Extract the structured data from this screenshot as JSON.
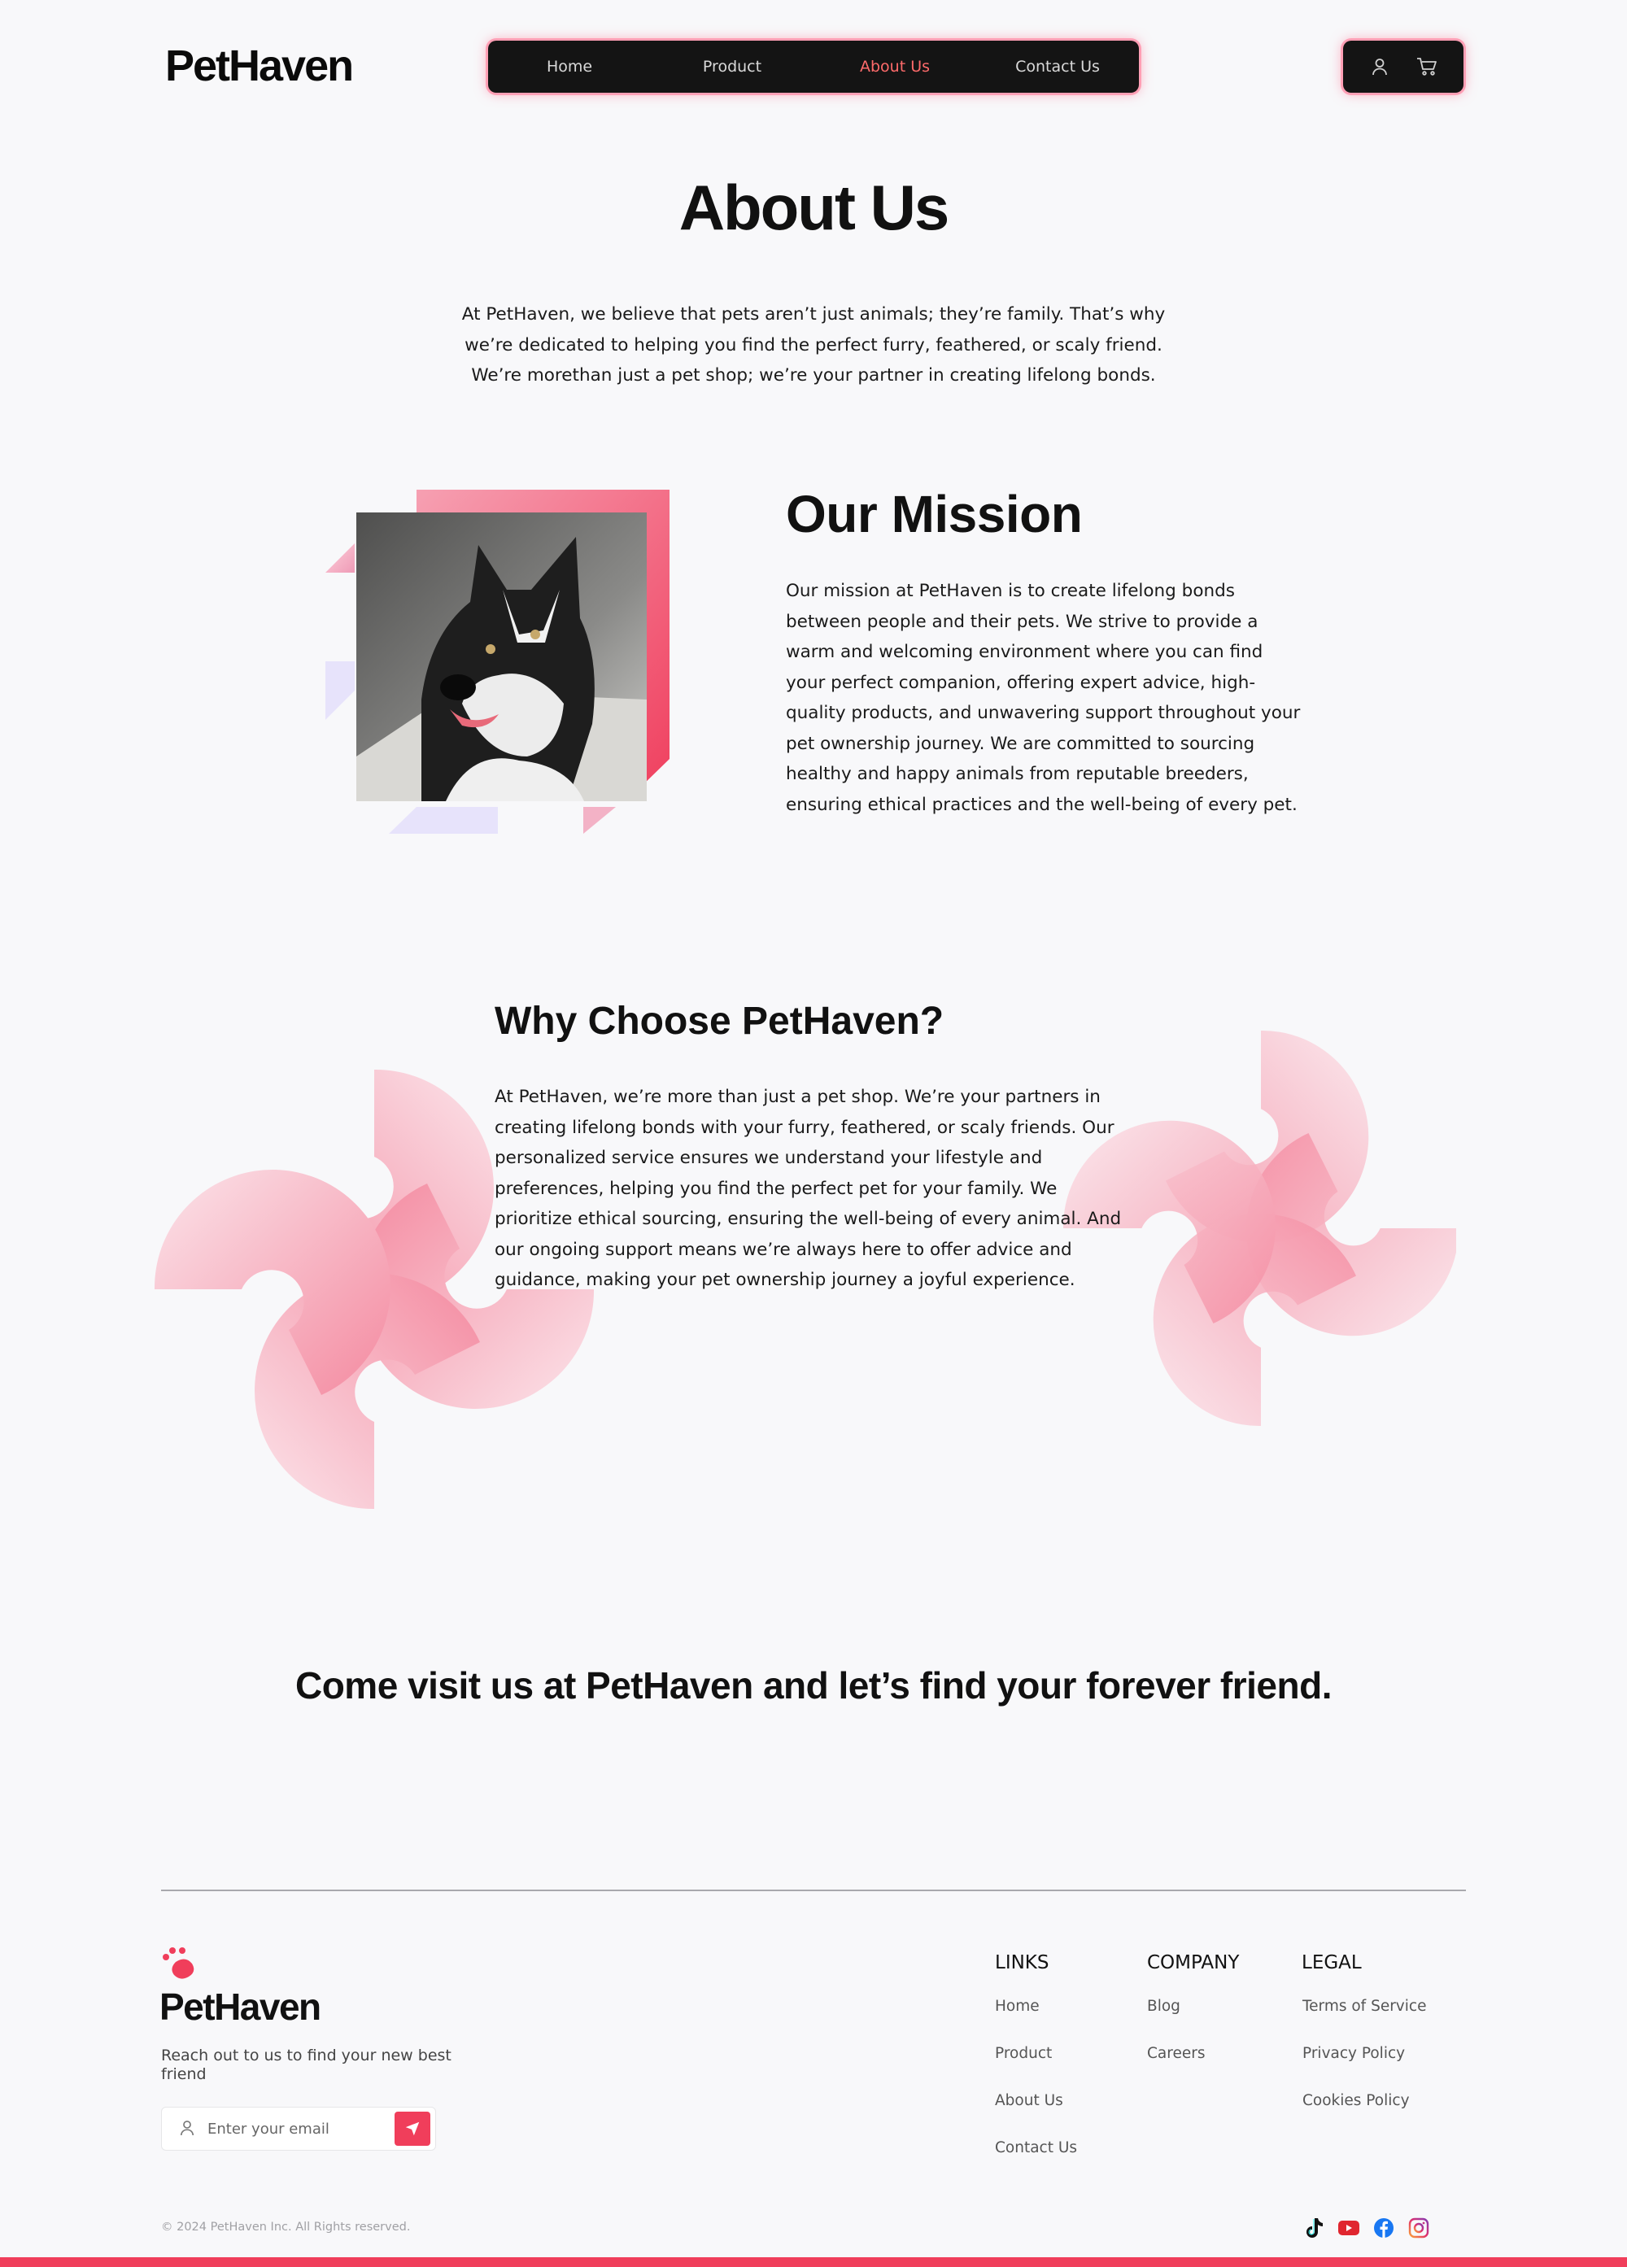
{
  "brand": {
    "name": "PetHaven",
    "accent": "#f03e5b",
    "nav_bg": "#141414"
  },
  "nav": {
    "items": [
      {
        "label": "Home"
      },
      {
        "label": "Product"
      },
      {
        "label": "About Us",
        "active": true
      },
      {
        "label": "Contact Us"
      }
    ],
    "icons": [
      "user-icon",
      "cart-icon"
    ]
  },
  "about": {
    "title": "About Us",
    "text": "At PetHaven, we believe that pets aren’t just animals; they’re family.  That’s why we’re  dedicated to helping you find the perfect furry,  feathered, or scaly friend. We’re morethan just a pet shop; we’re your partner in creating lifelong bonds."
  },
  "mission": {
    "title": "Our Mission",
    "text": "Our mission at PetHaven is to create lifelong bonds between people and their pets. We strive to provide a warm and welcoming environment where you can find your perfect companion, offering expert advice, high-quality products, and unwavering support throughout your pet ownership journey. We are committed to sourcing healthy and happy animals from reputable breeders, ensuring ethical practices and the well-being of every pet."
  },
  "why": {
    "title": "Why Choose PetHaven?",
    "text": "At PetHaven, we’re more than just a pet shop. We’re your partners in creating lifelong bonds with your furry, feathered, or scaly friends. Our personalized service ensures we understand your lifestyle and preferences, helping you find the perfect pet for your family. We prioritize ethical sourcing, ensuring the well-being of every animal. And our ongoing support means we’re always here to offer advice and guidance, making your pet ownership journey a joyful experience."
  },
  "cta": {
    "text": "Come visit us at PetHaven and let’s find your forever friend."
  },
  "footer": {
    "logo": "PetHaven",
    "tagline": "Reach out to us to find your new best friend",
    "email_placeholder": "Enter your email",
    "columns": [
      {
        "heading": "LINKS",
        "links": [
          "Home",
          "Product",
          "About Us",
          "Contact Us"
        ]
      },
      {
        "heading": "COMPANY",
        "links": [
          "Blog",
          "Careers"
        ]
      },
      {
        "heading": "LEGAL",
        "links": [
          "Terms of Service",
          "Privacy Policy",
          "Cookies Policy"
        ]
      }
    ],
    "copyright": "© 2024 PetHaven Inc. All Rights reserved.",
    "socials": [
      "tiktok-icon",
      "youtube-icon",
      "facebook-icon",
      "instagram-icon"
    ]
  }
}
